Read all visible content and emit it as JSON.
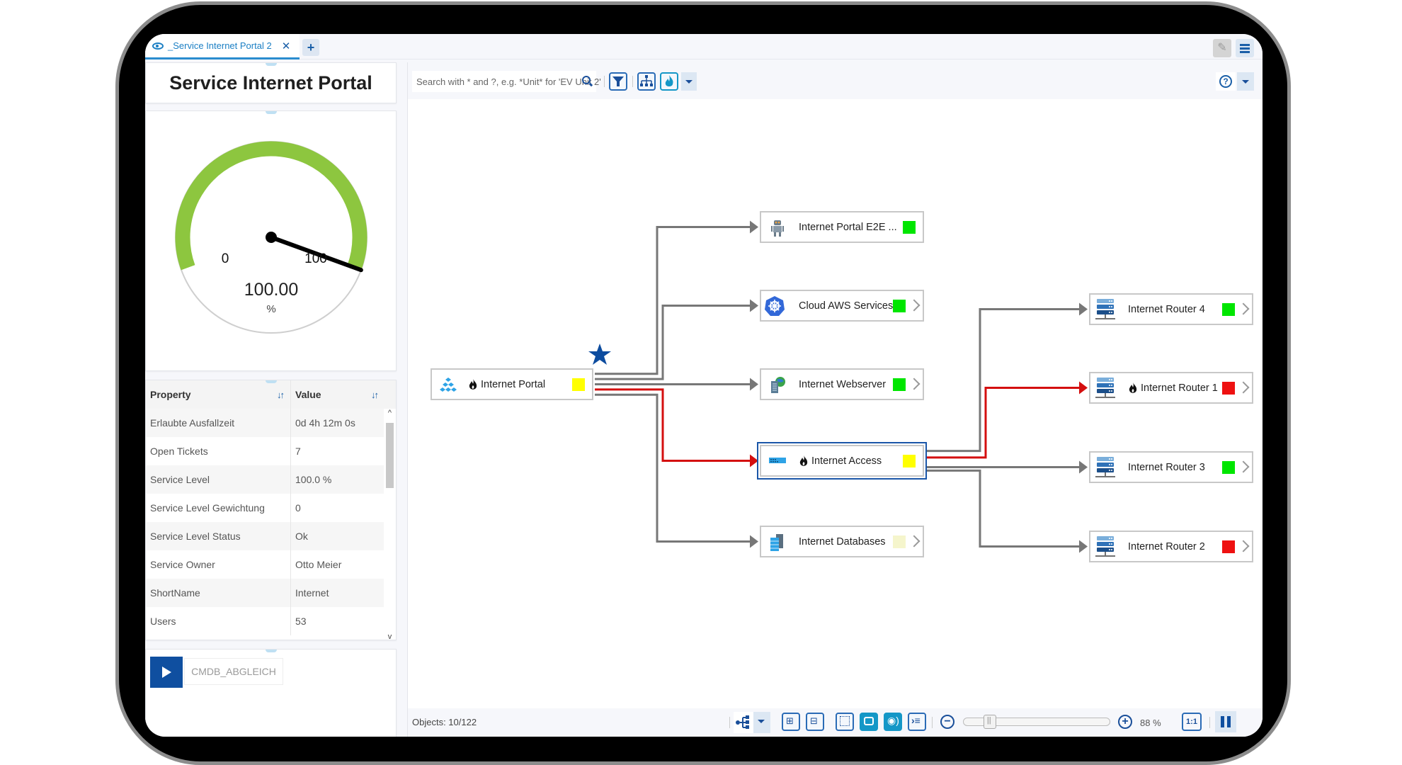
{
  "tabs": [
    {
      "label": "_Service Internet Portal 2",
      "icon": "eye-icon",
      "active": true
    }
  ],
  "add_tab_label": "+",
  "left_panel": {
    "title": "Service Internet Portal",
    "gauge": {
      "value": 100.0,
      "value_label": "100.00",
      "unit": "%",
      "min_label": "0",
      "max_label": "100",
      "min": 0,
      "max": 100,
      "arc_color": "#8dc63f"
    },
    "table": {
      "columns": [
        {
          "label": "Property",
          "sort_icon": "sort-arrows-icon"
        },
        {
          "label": "Value",
          "sort_icon": "sort-arrows-icon"
        }
      ],
      "rows": [
        {
          "property": "Erlaubte Ausfallzeit",
          "value": "0d 4h 12m 0s"
        },
        {
          "property": "Open Tickets",
          "value": "7"
        },
        {
          "property": "Service Level",
          "value": "100.0 %"
        },
        {
          "property": "Service Level Gewichtung",
          "value": "0"
        },
        {
          "property": "Service Level Status",
          "value": "Ok"
        },
        {
          "property": "Service Owner",
          "value": "Otto Meier"
        },
        {
          "property": "ShortName",
          "value": "Internet"
        },
        {
          "property": "Users",
          "value": "53"
        }
      ]
    },
    "action": {
      "label": "CMDB_ABGLEICH",
      "icon": "play-icon"
    }
  },
  "toolbar": {
    "search_placeholder": "Search with * and ?, e.g. *Unit* for 'EV Unit 2'",
    "buttons": [
      "filter-icon",
      "hierarchy-icon",
      "fire-icon"
    ],
    "help_label": "?"
  },
  "graph": {
    "status_colors": {
      "green": "#00e600",
      "yellow": "#ffff00",
      "red": "#ee1111",
      "lightyellow": "#f5f5cc"
    },
    "nodes": [
      {
        "id": "portal",
        "label": "Internet Portal",
        "icon": "cluster-icon",
        "fire": true,
        "status": "yellow",
        "more": false,
        "starred": true
      },
      {
        "id": "e2e",
        "label": "Internet Portal E2E ...",
        "icon": "robot-icon",
        "fire": false,
        "status": "green",
        "more": false
      },
      {
        "id": "aws",
        "label": "Cloud AWS Services",
        "icon": "kubernetes-icon",
        "fire": false,
        "status": "green",
        "more": true
      },
      {
        "id": "web",
        "label": "Internet Webserver",
        "icon": "webserver-icon",
        "fire": false,
        "status": "green",
        "more": true
      },
      {
        "id": "access",
        "label": "Internet Access",
        "icon": "switch-icon",
        "fire": true,
        "status": "yellow",
        "more": false,
        "selected": true
      },
      {
        "id": "db",
        "label": "Internet Databases",
        "icon": "database-icon",
        "fire": false,
        "status": "lightyellow",
        "more": true
      },
      {
        "id": "r4",
        "label": "Internet Router 4",
        "icon": "router-icon",
        "fire": false,
        "status": "green",
        "more": true
      },
      {
        "id": "r1",
        "label": "Internet Router 1",
        "icon": "router-icon",
        "fire": true,
        "status": "red",
        "more": true
      },
      {
        "id": "r3",
        "label": "Internet Router 3",
        "icon": "router-icon",
        "fire": false,
        "status": "green",
        "more": true
      },
      {
        "id": "r2",
        "label": "Internet Router 2",
        "icon": "router-icon",
        "fire": false,
        "status": "red",
        "more": true
      }
    ],
    "edges": [
      {
        "from": "portal",
        "to": "e2e",
        "critical": false
      },
      {
        "from": "portal",
        "to": "aws",
        "critical": false
      },
      {
        "from": "portal",
        "to": "web",
        "critical": false
      },
      {
        "from": "portal",
        "to": "access",
        "critical": true
      },
      {
        "from": "portal",
        "to": "db",
        "critical": false
      },
      {
        "from": "access",
        "to": "r4",
        "critical": false
      },
      {
        "from": "access",
        "to": "r1",
        "critical": true
      },
      {
        "from": "access",
        "to": "r3",
        "critical": false
      },
      {
        "from": "access",
        "to": "r2",
        "critical": false
      }
    ]
  },
  "bottombar": {
    "objects_label": "Objects: 10/122",
    "zoom_percent": 88,
    "zoom_label": "88 %",
    "one_to_one_label": "1:1"
  }
}
